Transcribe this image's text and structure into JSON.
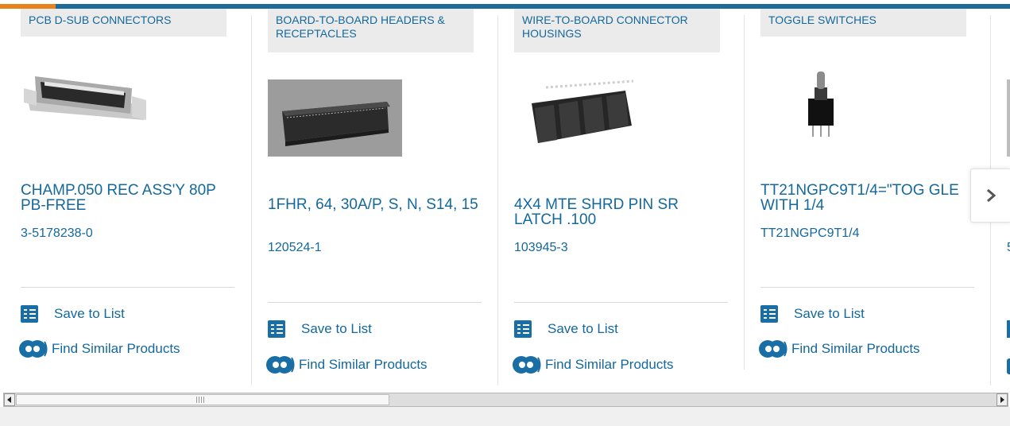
{
  "carousel": {
    "cards": [
      {
        "category": "PCB D-SUB CONNECTORS",
        "title": "CHAMP.050 REC ASS'Y 80P PB-FREE",
        "part_number": "3-5178238-0",
        "save_label": "Save to List",
        "similar_label": "Find Similar Products"
      },
      {
        "category": "BOARD-TO-BOARD HEADERS & RECEPTACLES",
        "title": "1FHR, 64, 30A/P, S, N, S14, 15",
        "part_number": "120524-1",
        "save_label": "Save to List",
        "similar_label": "Find Similar Products"
      },
      {
        "category": "WIRE-TO-BOARD CONNECTOR HOUSINGS",
        "title": "4X4 MTE SHRD PIN SR LATCH .100",
        "part_number": "103945-3",
        "save_label": "Save to List",
        "similar_label": "Find Similar Products"
      },
      {
        "category": "TOGGLE SWITCHES",
        "title": "TT21NGPC9T1/4=\"TOG GLE WITH 1/4",
        "part_number": "TT21NGPC9T1/4",
        "save_label": "Save to List",
        "similar_label": "Find Similar Products"
      },
      {
        "category": "",
        "title": "",
        "part_number": "5",
        "save_label": "",
        "similar_label": ""
      }
    ]
  },
  "icons": {
    "next": "chevron-right-icon",
    "save": "checklist-icon",
    "similar": "find-similar-icon"
  },
  "colors": {
    "link": "#14689c",
    "accent_bar": "#1f6b97",
    "accent_orange": "#e8821c",
    "category_bg": "#ebebeb"
  }
}
